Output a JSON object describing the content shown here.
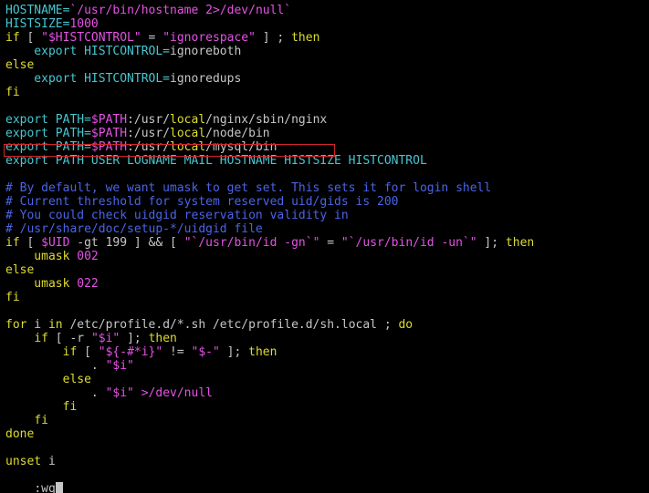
{
  "editor": {
    "lines": [
      [
        {
          "text": "HOSTNAME=",
          "role": "def"
        },
        {
          "text": "`/usr/bin/hostname 2>/dev/null`",
          "role": "str"
        }
      ],
      [
        {
          "text": "HISTSIZE=",
          "role": "def"
        },
        {
          "text": "1000",
          "role": "num"
        }
      ],
      [
        {
          "text": "if",
          "role": "kw"
        },
        {
          "text": " [ ",
          "role": "plain"
        },
        {
          "text": "\"$HISTCONTROL\"",
          "role": "str"
        },
        {
          "text": " = ",
          "role": "plain"
        },
        {
          "text": "\"ignorespace\"",
          "role": "str"
        },
        {
          "text": " ] ; ",
          "role": "plain"
        },
        {
          "text": "then",
          "role": "kw"
        }
      ],
      [
        {
          "text": "    export HISTCONTROL=",
          "role": "def"
        },
        {
          "text": "ignoreboth",
          "role": "plain"
        }
      ],
      [
        {
          "text": "else",
          "role": "kw"
        }
      ],
      [
        {
          "text": "    export HISTCONTROL=",
          "role": "def"
        },
        {
          "text": "ignoredups",
          "role": "plain"
        }
      ],
      [
        {
          "text": "fi",
          "role": "kw"
        }
      ],
      [
        {
          "text": "",
          "role": "plain"
        }
      ],
      [
        {
          "text": "export PATH=",
          "role": "def"
        },
        {
          "text": "$PATH",
          "role": "str"
        },
        {
          "text": ":/usr/",
          "role": "plain"
        },
        {
          "text": "local",
          "role": "kw"
        },
        {
          "text": "/nginx/sbin/nginx",
          "role": "plain"
        }
      ],
      [
        {
          "text": "export PATH=",
          "role": "def"
        },
        {
          "text": "$PATH",
          "role": "str"
        },
        {
          "text": ":/usr/",
          "role": "plain"
        },
        {
          "text": "local",
          "role": "kw"
        },
        {
          "text": "/node/bin",
          "role": "plain"
        }
      ],
      [
        {
          "text": "export PATH=",
          "role": "def"
        },
        {
          "text": "$PATH",
          "role": "str"
        },
        {
          "text": ":/usr/",
          "role": "plain"
        },
        {
          "text": "local",
          "role": "kw"
        },
        {
          "text": "/mysql/bin",
          "role": "plain"
        }
      ],
      [
        {
          "text": "export PATH USER LOGNAME MAIL HOSTNAME HISTSIZE HISTCONTROL",
          "role": "def"
        }
      ],
      [
        {
          "text": "",
          "role": "plain"
        }
      ],
      [
        {
          "text": "# By default, we want umask to get set. This sets it for login shell",
          "role": "com"
        }
      ],
      [
        {
          "text": "# Current threshold for system reserved uid/gids is 200",
          "role": "com"
        }
      ],
      [
        {
          "text": "# You could check uidgid reservation validity in",
          "role": "com"
        }
      ],
      [
        {
          "text": "# /usr/share/doc/setup-*/uidgid file",
          "role": "com"
        }
      ],
      [
        {
          "text": "if",
          "role": "kw"
        },
        {
          "text": " [ ",
          "role": "plain"
        },
        {
          "text": "$UID",
          "role": "str"
        },
        {
          "text": " -gt 199 ] && [ ",
          "role": "plain"
        },
        {
          "text": "\"`/usr/bin/id -gn`\"",
          "role": "str"
        },
        {
          "text": " = ",
          "role": "plain"
        },
        {
          "text": "\"`/usr/bin/id -un`\"",
          "role": "str"
        },
        {
          "text": " ]; ",
          "role": "plain"
        },
        {
          "text": "then",
          "role": "kw"
        }
      ],
      [
        {
          "text": "    umask ",
          "role": "kw"
        },
        {
          "text": "002",
          "role": "num"
        }
      ],
      [
        {
          "text": "else",
          "role": "kw"
        }
      ],
      [
        {
          "text": "    umask ",
          "role": "kw"
        },
        {
          "text": "022",
          "role": "num"
        }
      ],
      [
        {
          "text": "fi",
          "role": "kw"
        }
      ],
      [
        {
          "text": "",
          "role": "plain"
        }
      ],
      [
        {
          "text": "for",
          "role": "kw"
        },
        {
          "text": " i ",
          "role": "plain"
        },
        {
          "text": "in",
          "role": "kw"
        },
        {
          "text": " /etc/profile.d/*.sh /etc/profile.d/sh.local ; ",
          "role": "plain"
        },
        {
          "text": "do",
          "role": "kw"
        }
      ],
      [
        {
          "text": "    ",
          "role": "plain"
        },
        {
          "text": "if",
          "role": "kw"
        },
        {
          "text": " [ -r ",
          "role": "plain"
        },
        {
          "text": "\"$i\"",
          "role": "str"
        },
        {
          "text": " ]; ",
          "role": "plain"
        },
        {
          "text": "then",
          "role": "kw"
        }
      ],
      [
        {
          "text": "        ",
          "role": "plain"
        },
        {
          "text": "if",
          "role": "kw"
        },
        {
          "text": " [ ",
          "role": "plain"
        },
        {
          "text": "\"${-#*i}\"",
          "role": "str"
        },
        {
          "text": " != ",
          "role": "plain"
        },
        {
          "text": "\"$-\"",
          "role": "str"
        },
        {
          "text": " ]; ",
          "role": "plain"
        },
        {
          "text": "then",
          "role": "kw"
        }
      ],
      [
        {
          "text": "            . ",
          "role": "plain"
        },
        {
          "text": "\"$i\"",
          "role": "str"
        }
      ],
      [
        {
          "text": "        ",
          "role": "plain"
        },
        {
          "text": "else",
          "role": "kw"
        }
      ],
      [
        {
          "text": "            . ",
          "role": "plain"
        },
        {
          "text": "\"$i\"",
          "role": "str"
        },
        {
          "text": " >/dev/null",
          "role": "str"
        }
      ],
      [
        {
          "text": "        ",
          "role": "plain"
        },
        {
          "text": "fi",
          "role": "kw"
        }
      ],
      [
        {
          "text": "    ",
          "role": "plain"
        },
        {
          "text": "fi",
          "role": "kw"
        }
      ],
      [
        {
          "text": "done",
          "role": "kw"
        }
      ],
      [
        {
          "text": "",
          "role": "plain"
        }
      ],
      [
        {
          "text": "unset",
          "role": "kw"
        },
        {
          "text": " i",
          "role": "plain"
        }
      ]
    ]
  },
  "command_line": {
    "text": ":wq"
  },
  "colors": {
    "background": "#000000",
    "plain": "#c7c7c7",
    "keyword": "#dedc30",
    "string": "#e552e5",
    "definition": "#45c7d1",
    "comment": "#4a64e8",
    "highlight_border": "#d0262a"
  }
}
